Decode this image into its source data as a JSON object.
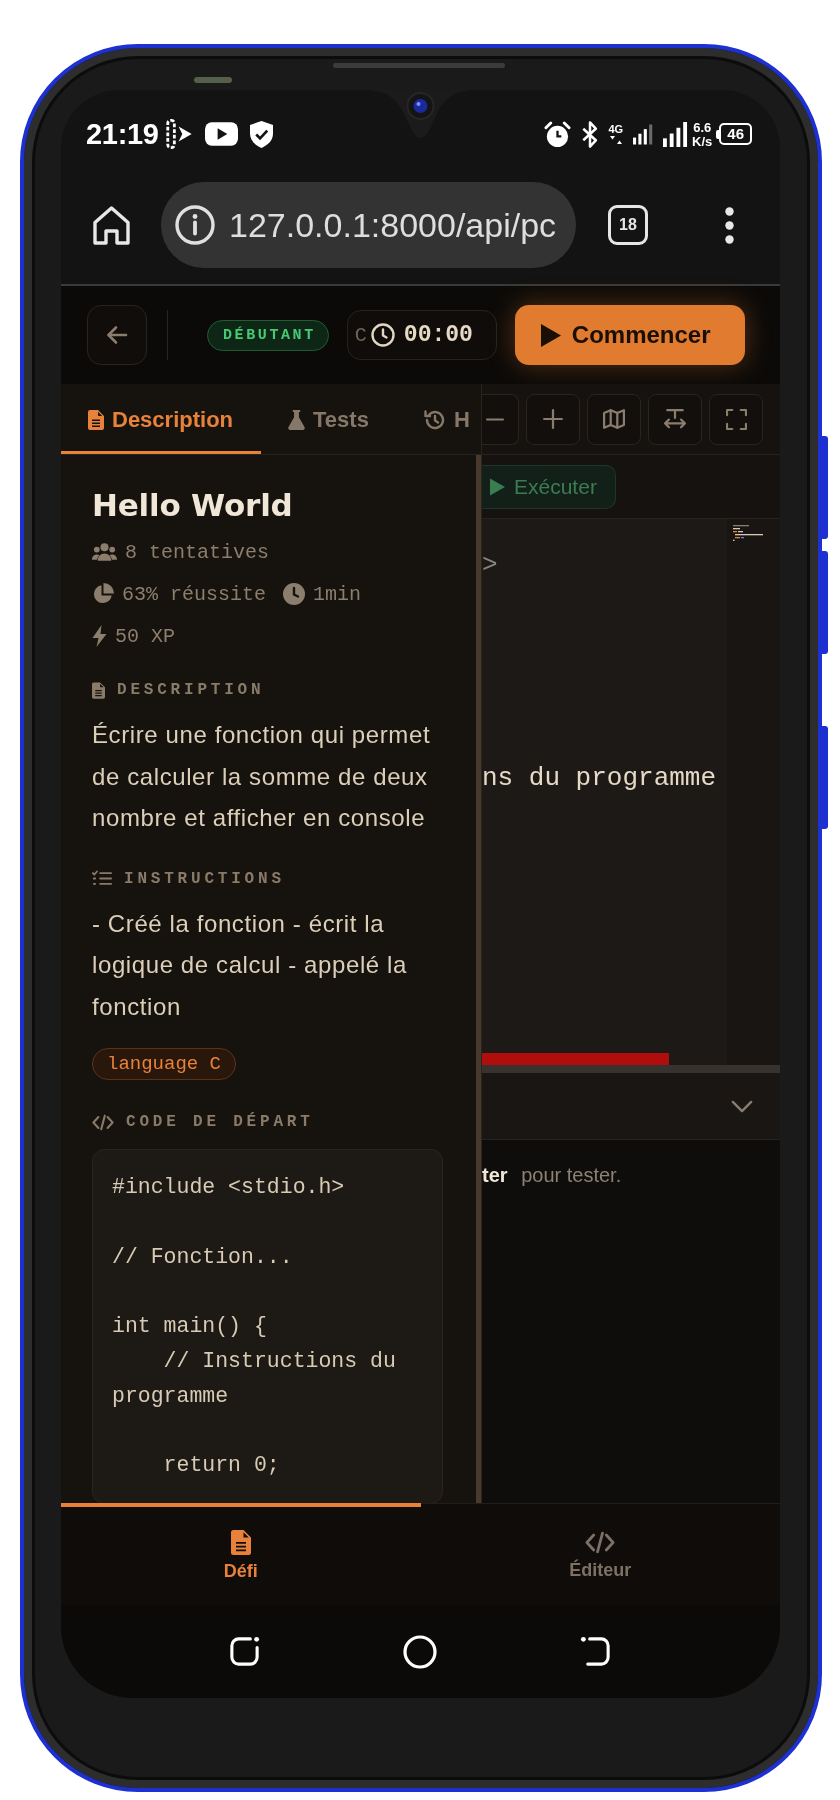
{
  "status_bar": {
    "time": "21:19",
    "network_type": "4G",
    "network_speed": "6.6",
    "network_speed_unit": "K/s",
    "battery": "46"
  },
  "browser": {
    "url": "127.0.0.1:8000/api/pc",
    "tab_count": "18"
  },
  "header": {
    "level_badge": "DÉBUTANT",
    "language": "C",
    "timer": "00:00",
    "start_button": "Commencer"
  },
  "panel_tabs": [
    {
      "label": "Description",
      "selected": true
    },
    {
      "label": "Tests",
      "selected": false
    },
    {
      "label": "H",
      "selected": false
    }
  ],
  "challenge": {
    "title": "Hello World",
    "stats": [
      "8 tentatives",
      "63% réussite",
      "1min",
      "50 XP"
    ],
    "blocks": [
      {
        "kind": "section",
        "heading": "DESCRIPTION",
        "text": "Écrire une fonction qui permet de calculer la somme de deux nombre et afficher en console"
      },
      {
        "kind": "section",
        "heading": "INSTRUCTIONS",
        "text": "- Créé la fonction - écrit la logique de calcul - appelé la fonction"
      },
      {
        "kind": "tags",
        "tags": [
          "language C"
        ]
      },
      {
        "kind": "code",
        "heading": "CODE DE DÉPART",
        "code": "#include <stdio.h>\n\n// Fonction...\n\nint main() {\n    // Instructions du programme\n\n    return 0;"
      }
    ]
  },
  "editor": {
    "run_button": "Exécuter",
    "lines": [
      ">",
      "ns du programme"
    ],
    "output_message": "**ter** pour tester."
  },
  "bottom_nav": [
    {
      "label": "Défi",
      "selected": true
    },
    {
      "label": "Éditeur",
      "selected": false
    }
  ]
}
